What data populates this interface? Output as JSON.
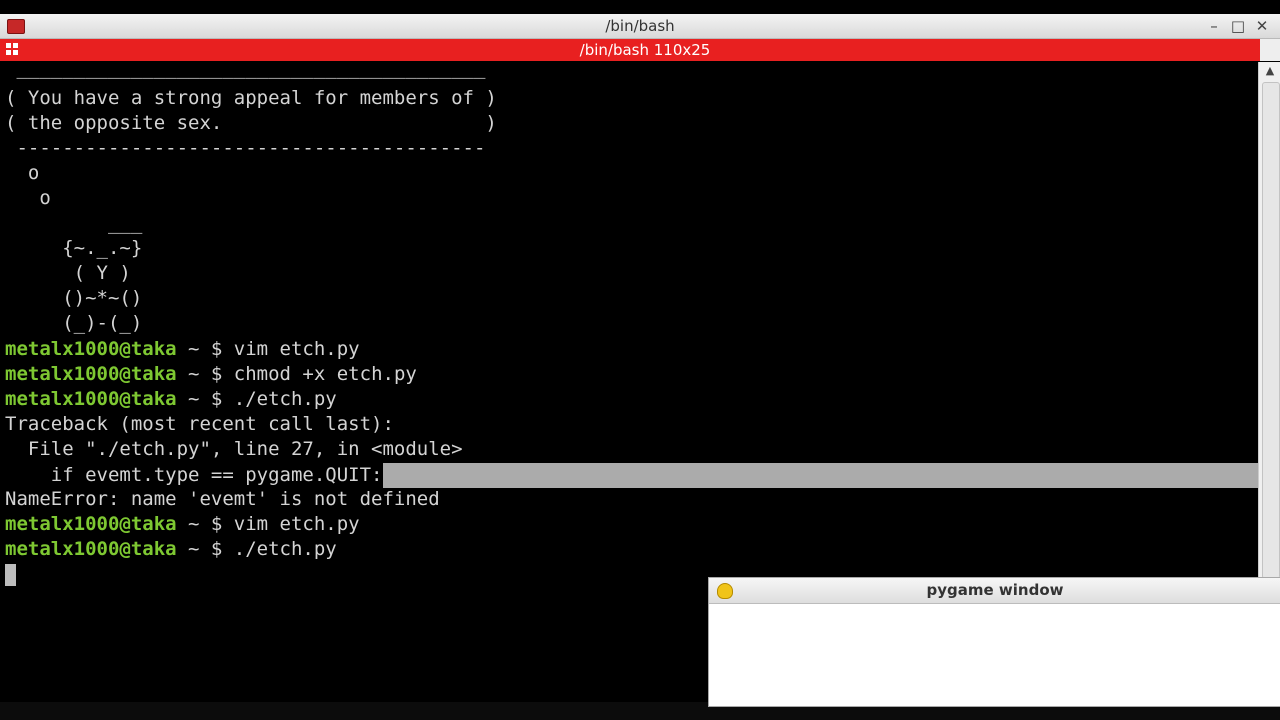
{
  "window": {
    "title": "/bin/bash"
  },
  "tab": {
    "title": "/bin/bash 110x25"
  },
  "terminal": {
    "output_top": [
      " _________________________________________",
      "( You have a strong appeal for members of )",
      "( the opposite sex.                       )",
      " -----------------------------------------",
      "  o",
      "   o",
      "         ___",
      "     {~._.~}",
      "      ( Y )",
      "     ()~*~()",
      "     (_)-(_)"
    ],
    "prompt_user": "metalx1000@taka",
    "prompt_tail": " ~ $ ",
    "cmd1": "vim etch.py",
    "cmd2": "chmod +x etch.py",
    "cmd3": "./etch.py",
    "traceback": "Traceback (most recent call last):",
    "file_line": "  File \"./etch.py\", line 27, in <module>",
    "code_line": "    if evemt.type == pygame.QUIT:",
    "error_line": "NameError: name 'evemt' is not defined",
    "cmd4": "vim etch.py",
    "cmd5": "./etch.py"
  },
  "pygame_window": {
    "title": "pygame window"
  },
  "icons": {
    "app": "terminal-icon",
    "tab": "tab-grid-icon",
    "minimize": "minimize-icon",
    "maximize": "maximize-icon",
    "close": "close-icon",
    "scroll_up": "scroll-up-icon",
    "pygame": "python-icon"
  },
  "colors": {
    "tab_bar": "#e82020",
    "prompt": "#7ec832",
    "selection": "#ababab"
  }
}
